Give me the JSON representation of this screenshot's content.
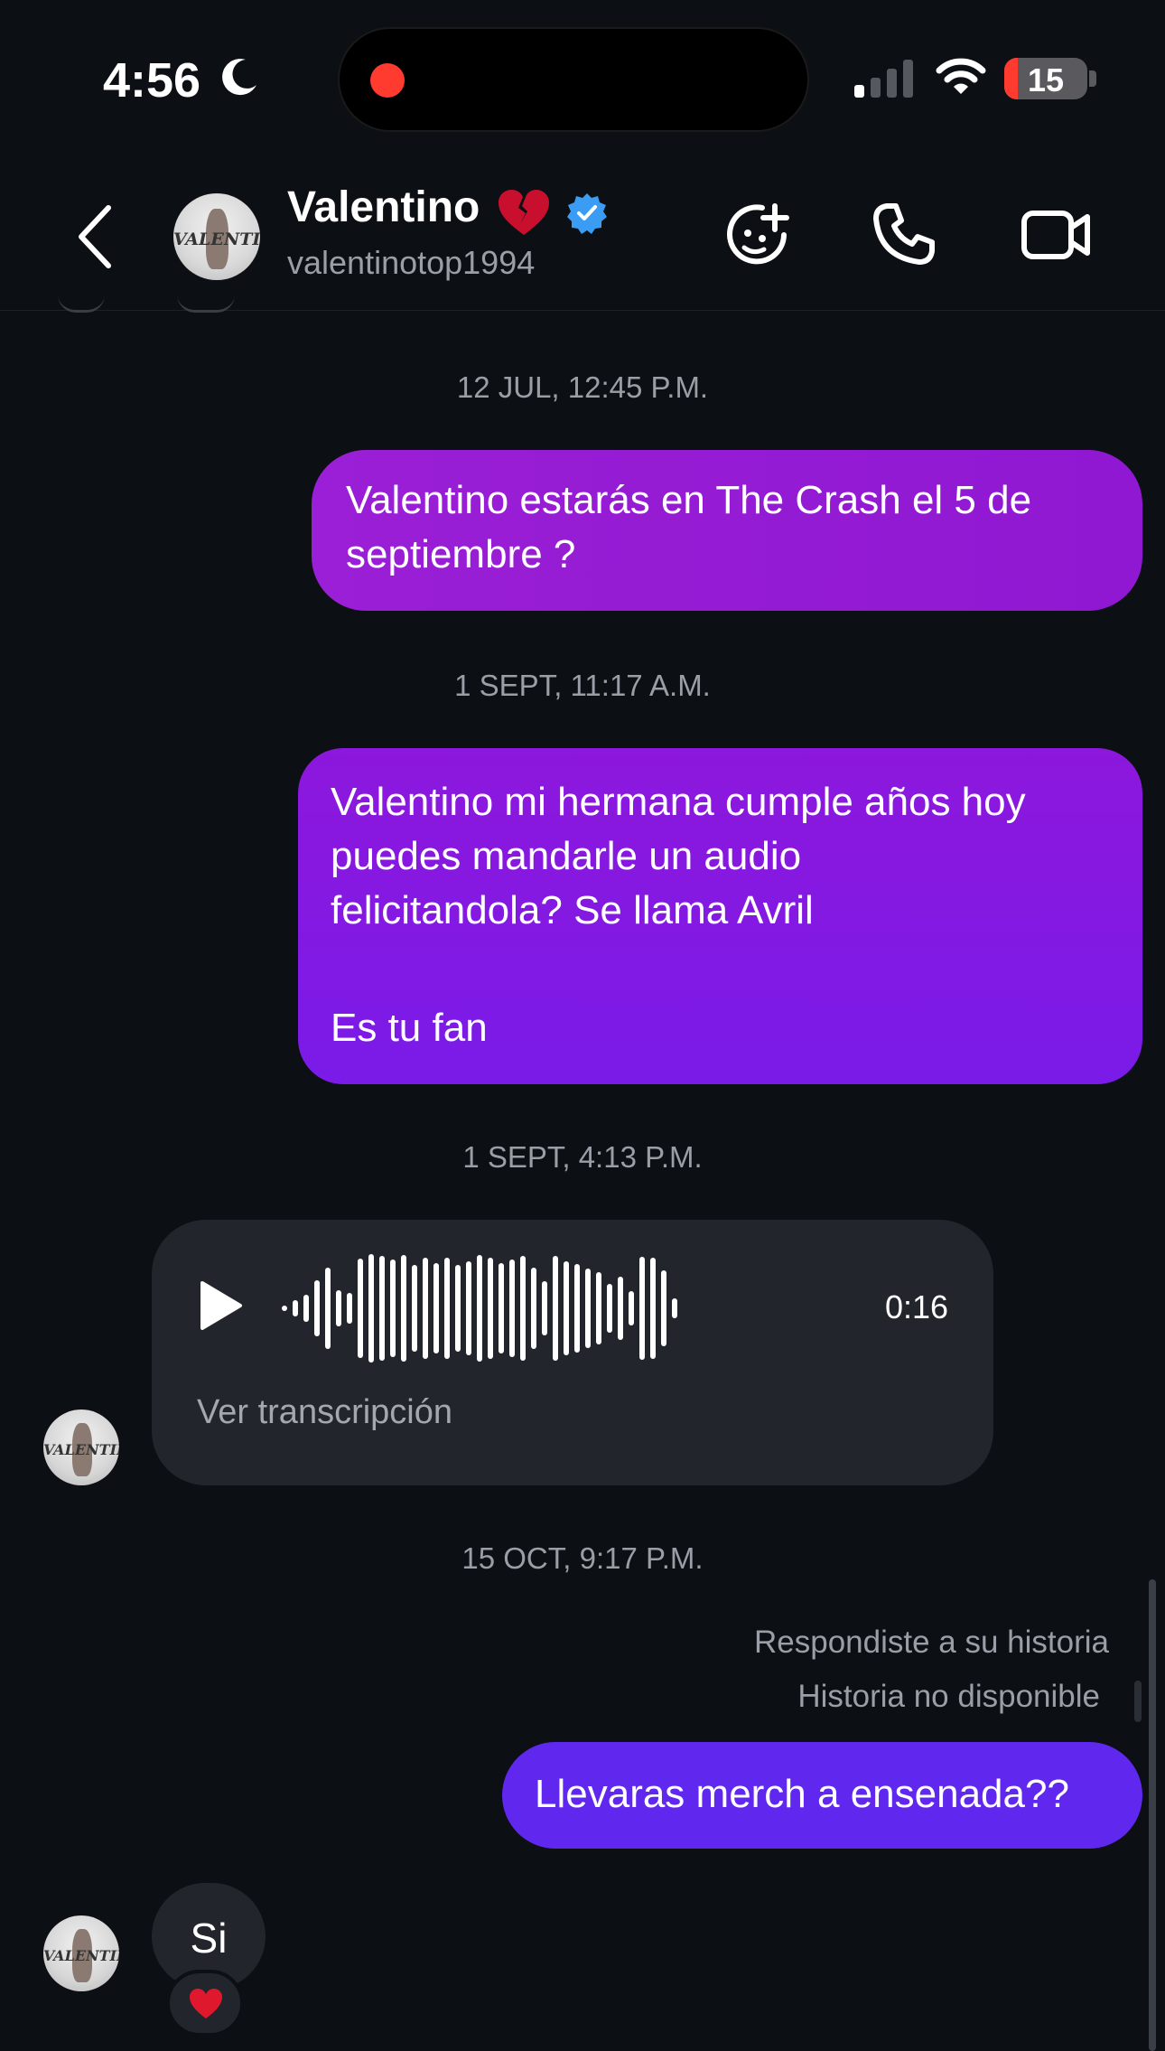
{
  "status_bar": {
    "time": "4:56",
    "battery": "15",
    "icons": [
      "moon-icon",
      "signal-icon",
      "wifi-icon",
      "battery-icon"
    ]
  },
  "header": {
    "name": "Valentino",
    "username": "valentinotop1994",
    "avatar_text": "VALENTINO",
    "icons": [
      "back-icon",
      "broken-heart-icon",
      "verified-badge-icon",
      "sticker-icon",
      "phone-icon",
      "video-camera-icon"
    ],
    "accent_verified": "#3b9cf3"
  },
  "messages": {
    "ts1": "12 JUL, 12:45 P.M.",
    "msg1": "Valentino estarás en The Crash el 5 de septiembre ?",
    "ts2": "1 SEPT, 11:17 A.M.",
    "msg2_line1": "Valentino mi hermana cumple años hoy",
    "msg2_line2": "puedes mandarle un audio",
    "msg2_line3": "felicitandola? Se llama Avril",
    "msg2_line4": "Es tu fan",
    "ts3": "1 SEPT, 4:13 P.M.",
    "voice_duration": "0:16",
    "voice_transcript": "Ver transcripción",
    "ts4": "15 OCT, 9:17 P.M.",
    "reply_label": "Respondiste a su historia",
    "story_unavailable": "Historia no disponible",
    "msg3": "Llevaras merch a ensenada??",
    "reply_in": "Si",
    "reaction": "❤️"
  },
  "colors": {
    "background": "#0c0f14",
    "bubble_out_1": "#9a1fd6",
    "bubble_out_2": "#8418e0",
    "bubble_out_3": "#6028ee",
    "bubble_in": "#22252b"
  }
}
